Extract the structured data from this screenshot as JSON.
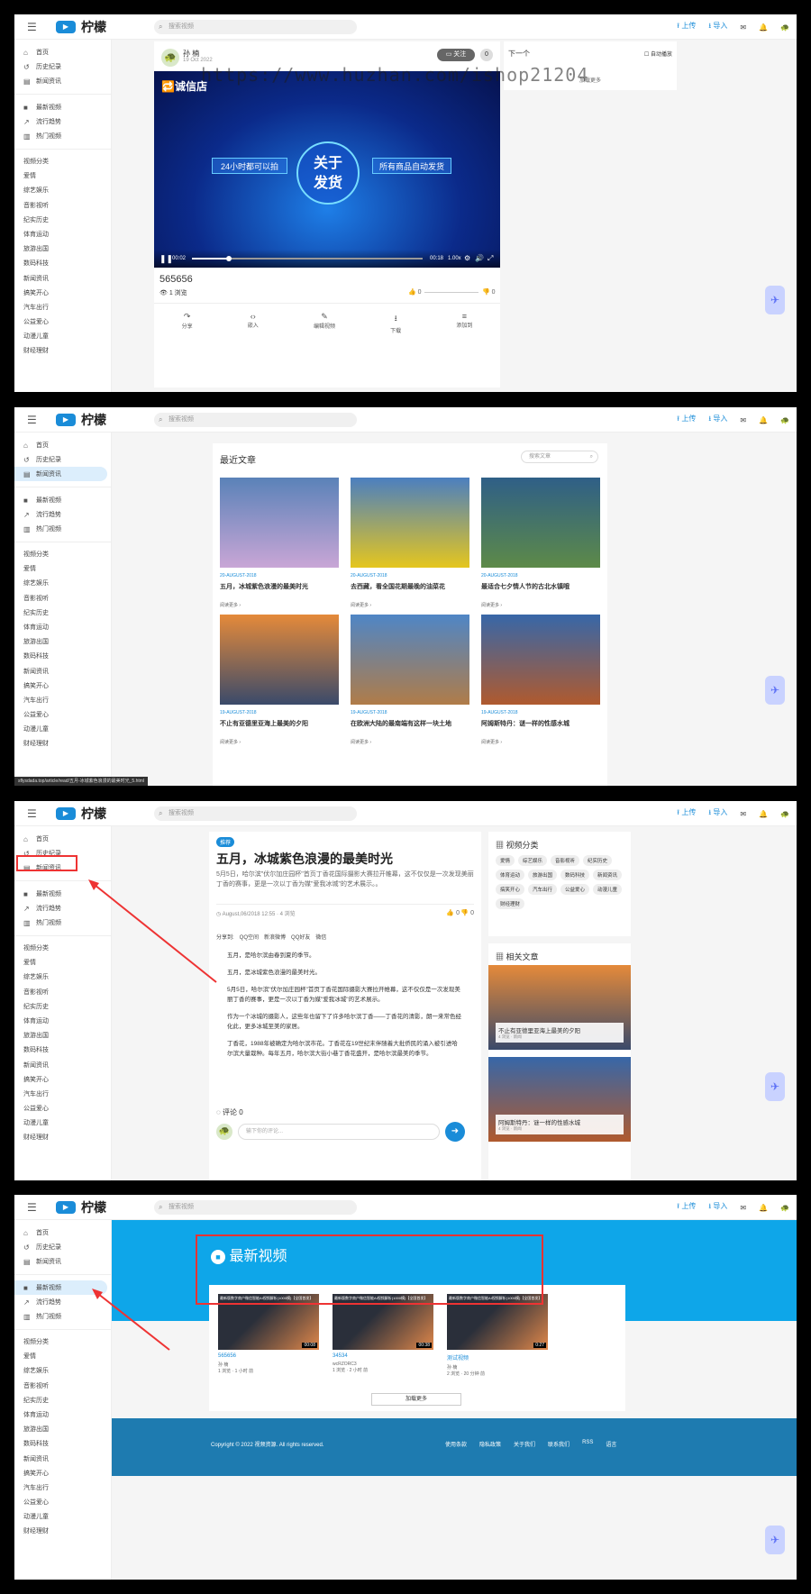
{
  "app": {
    "logo_text": "柠檬",
    "search_placeholder": "搜索视频",
    "upload": "上传",
    "import": "导入",
    "hamburger": "☰",
    "logo_icon": "▶"
  },
  "sidebar": {
    "main": [
      {
        "icon": "⌂",
        "label": "首页"
      },
      {
        "icon": "↺",
        "label": "历史纪录"
      },
      {
        "icon": "▤",
        "label": "新闻资讯"
      }
    ],
    "main_p4": [
      {
        "icon": "⌂",
        "label": "首页"
      },
      {
        "icon": "↺",
        "label": "历史纪录"
      },
      {
        "icon": "▤",
        "label": "新闻资讯"
      }
    ],
    "video": [
      {
        "icon": "■",
        "label": "最新视频"
      },
      {
        "icon": "↗",
        "label": "流行趋势"
      },
      {
        "icon": "▥",
        "label": "热门视频"
      }
    ],
    "cat_title": "视频分类",
    "cats": [
      "爱情",
      "综艺娱乐",
      "音影视听",
      "纪实历史",
      "体育运动",
      "旅游出国",
      "数码科技",
      "新闻资讯",
      "搞笑开心",
      "汽车出行",
      "公益爱心",
      "动漫儿童",
      "财经理财"
    ],
    "cats_p4": [
      "爱情",
      "综艺娱乐",
      "音影视听",
      "纪实历史",
      "体育运动",
      "旅游出国",
      "数码科技",
      "新闻资讯",
      "搞笑开心",
      "汽车出行",
      "公益爱心",
      "动漫儿童",
      "财经理财"
    ]
  },
  "p1": {
    "uploader": "孙 楠",
    "date": "19 Oct 2022",
    "follow": "关注",
    "follow_count": "0",
    "banner_left": "24小时都可以拍",
    "banner_center": "关于\n发货",
    "banner_right": "所有商品自动发货",
    "shop_logo": "诚信店",
    "time_cur": "00:02",
    "time_total": "00:18",
    "speed": "1.00x",
    "title": "565656",
    "views": "1 浏览",
    "likes": "0",
    "dislikes": "0",
    "actions": [
      "分享",
      "嵌入",
      "编辑视频",
      "下载",
      "添加到"
    ],
    "next_title": "下一个",
    "autoplay": "自动播放",
    "load_more": "加载更多",
    "watermark": "https://www.huzhan.com/ishop21204"
  },
  "p2": {
    "section_title": "最近文章",
    "search_placeholder": "搜索文章",
    "read_more": "阅读更多 ›",
    "articles": [
      {
        "date": "20-AUGUST-2018",
        "title": "五月，冰城紫色浪漫的最美时光",
        "c1": "#5a82b8",
        "c2": "#c9a6d6"
      },
      {
        "date": "20-AUGUST-2018",
        "title": "去西藏，看全国花期最晚的油菜花",
        "c1": "#4b7fc0",
        "c2": "#e5c61e"
      },
      {
        "date": "20-AUGUST-2018",
        "title": "最适合七夕情人节的古北水镇哦",
        "c1": "#2f5f87",
        "c2": "#5d8a48"
      },
      {
        "date": "19-AUGUST-2018",
        "title": "不止有亚德里亚海上最美的夕阳",
        "c1": "#e58a3a",
        "c2": "#3a4a6a"
      },
      {
        "date": "19-AUGUST-2018",
        "title": "在欧洲大陆的最南端有这样一块土地",
        "c1": "#4f86c6",
        "c2": "#b07c48"
      },
      {
        "date": "19-AUGUST-2018",
        "title": "阿姆斯特丹：谜一样的性感水城",
        "c1": "#3767a8",
        "c2": "#b05a2e"
      }
    ],
    "status_url": "sflysdada.top/article/read/五月-冰城紫色浪漫的最美时光_5.html"
  },
  "p3": {
    "tag": "推荐",
    "title": "五月，冰城紫色浪漫的最美时光",
    "summary": "5月5日，哈尔滨\"伏尔加庄园杯\"首页丁香花国际摄影大赛拉开帷幕，这不仅仅是一次发现美丽丁香的赛事，更是一次以丁香为媒\"爱我冰城\"的艺术展示。。",
    "meta": "August,06/2018 12:55 · 4 浏览",
    "likes": "0",
    "dislikes": "0",
    "share": [
      "分享到:",
      "QQ空间",
      "新浪微博",
      "QQ好友",
      "微信"
    ],
    "paras": [
      "五月，是哈尔滨由春到夏的季节。",
      "五月，是冰城紫色浪漫的最美时光。",
      "5月5日，哈尔滨\"伏尔加庄园杯\"首页丁香花国际摄影大赛拉开帷幕，这不仅仅是一次发现美丽丁香的赛事，更是一次以丁香为媒\"爱我冰城\"的艺术展示。",
      "作为一个冰城的摄影人，这些年也留下了许多哈尔滨丁香——丁香花的清影，朗一来常色经化此，更多冰城至美的家居。",
      "丁香花，1988年被确定为哈尔滨市花。丁香花在19世纪末伴随着大批侨民的涌入被引进哈尔滨大量栽种。每年五月，哈尔滨大街小巷丁香花盛开，是哈尔滨最美的季节。"
    ],
    "comments": "评论 0",
    "comment_placeholder": "输下你的评论...",
    "cat_title": "视频分类",
    "cats": [
      "爱情",
      "综艺娱乐",
      "音影视听",
      "纪实历史",
      "体育运动",
      "旅游出国",
      "数码科技",
      "新闻资讯",
      "搞笑开心",
      "汽车出行",
      "公益爱心",
      "动漫儿童",
      "财经理财"
    ],
    "related_title": "相关文章",
    "related": [
      {
        "title": "不止有亚德里亚海上最美的夕阳",
        "meta": "4 浏览 · 新闻"
      },
      {
        "title": "阿姆斯特丹：谜一样的性感水城",
        "meta": "4 浏览 · 新闻"
      }
    ]
  },
  "p4": {
    "section_title": "最新视频",
    "videos": [
      {
        "title": "565656",
        "thumb": "最新版数字商户微信智能AI视频解析(1000模)【全国首发】",
        "duration": "00:08",
        "author": "孙 楠",
        "meta": "1 浏览 · 1 小时 前"
      },
      {
        "title": "34534",
        "thumb": "最新版数字商户微信智能AI视频解析(1000模)【全国首发】",
        "duration": "00:38",
        "author": "wcRZORC3",
        "meta": "1 浏览 · 2 小时 前"
      },
      {
        "title": "测试视频",
        "thumb": "最新版数字商户微信智能AI视频解析(1000模)【全国首发】",
        "duration": "0:27",
        "author": "孙 楠",
        "meta": "2 浏览 · 20 分钟 前"
      }
    ],
    "load_more": "加载更多",
    "copyright": "Copyright © 2022 视频资源. All rights reserved.",
    "footer_links": [
      "使用条款",
      "隐私政策",
      "关于我们",
      "联系我们",
      "RSS",
      "语言"
    ]
  }
}
